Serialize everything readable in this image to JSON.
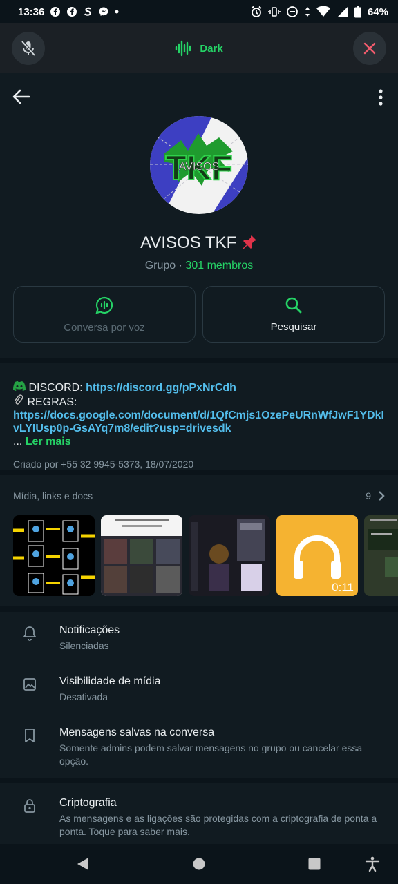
{
  "status_bar": {
    "time": "13:36",
    "battery": "64%"
  },
  "call_bar": {
    "label": "Dark"
  },
  "group": {
    "name": "AVISOS TKF",
    "type": "Grupo",
    "separator": " · ",
    "members": "301 membros"
  },
  "actions": {
    "voice_label": "Conversa por voz",
    "search_label": "Pesquisar"
  },
  "description": {
    "discord_label": "DISCORD:",
    "discord_url": "https://discord.gg/pPxNrCdh",
    "rules_label": "REGRAS:",
    "rules_url": "https://docs.google.com/document/d/1QfCmjs1OzePeURnWfJwF1YDkIvLYIUsp0p-GsAYq7m8/edit?usp=drivesdk",
    "ellipsis": "...",
    "read_more": "Ler mais",
    "created": "Criado por +55 32 9945-5373, 18/07/2020"
  },
  "media": {
    "title": "Mídia, links e docs",
    "count": "9",
    "audio_duration": "0:11"
  },
  "settings": {
    "notifications_title": "Notificações",
    "notifications_sub": "Silenciadas",
    "visibility_title": "Visibilidade de mídia",
    "visibility_sub": "Desativada",
    "saved_title": "Mensagens salvas na conversa",
    "saved_sub": "Somente admins podem salvar mensagens no grupo ou cancelar essa opção.",
    "crypto_title": "Criptografia",
    "crypto_sub": "As mensagens e as ligações são protegidas com a criptografia de ponta a ponta. Toque para saber mais."
  },
  "colors": {
    "accent": "#25d366",
    "link": "#53bdeb",
    "background": "#111b21",
    "danger": "#f15c6d"
  }
}
